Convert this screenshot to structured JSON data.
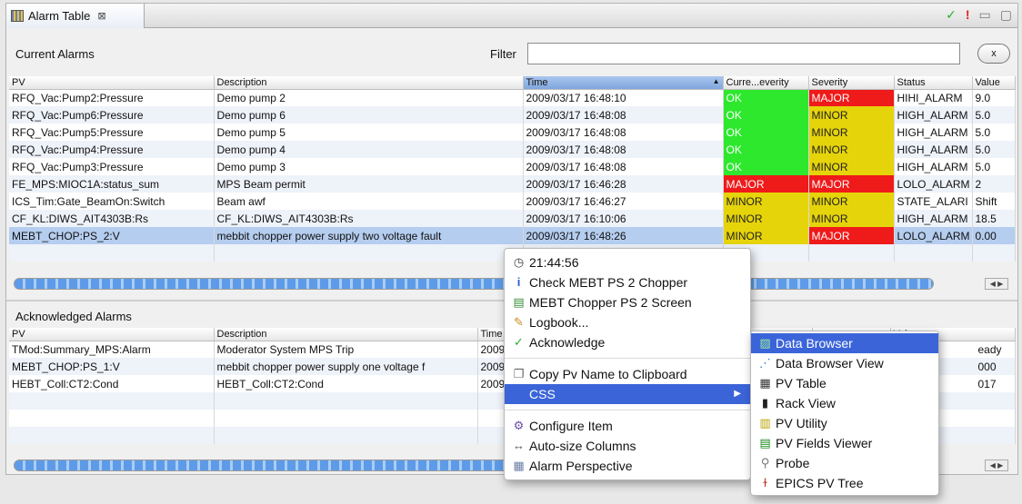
{
  "tab": {
    "title": "Alarm Table",
    "close": "⊠"
  },
  "toolbar_icons": {
    "check": "✓",
    "alert": "!",
    "minimize": "▭",
    "maximize": "▢"
  },
  "current": {
    "title": "Current Alarms",
    "filter_label": "Filter",
    "filter_value": "",
    "clear_label": "x",
    "columns": [
      "PV",
      "Description",
      "Time",
      "Curre...everity",
      "Severity",
      "Status",
      "Value"
    ],
    "rows": [
      {
        "pv": "RFQ_Vac:Pump2:Pressure",
        "desc": "Demo pump 2",
        "time": "2009/03/17 16:48:10",
        "cur": "OK",
        "sev": "MAJOR",
        "status": "HIHI_ALARM",
        "value": "9.0"
      },
      {
        "pv": "RFQ_Vac:Pump6:Pressure",
        "desc": "Demo pump 6",
        "time": "2009/03/17 16:48:08",
        "cur": "OK",
        "sev": "MINOR",
        "status": "HIGH_ALARM",
        "value": "5.0"
      },
      {
        "pv": "RFQ_Vac:Pump5:Pressure",
        "desc": "Demo pump 5",
        "time": "2009/03/17 16:48:08",
        "cur": "OK",
        "sev": "MINOR",
        "status": "HIGH_ALARM",
        "value": "5.0"
      },
      {
        "pv": "RFQ_Vac:Pump4:Pressure",
        "desc": "Demo pump 4",
        "time": "2009/03/17 16:48:08",
        "cur": "OK",
        "sev": "MINOR",
        "status": "HIGH_ALARM",
        "value": "5.0"
      },
      {
        "pv": "RFQ_Vac:Pump3:Pressure",
        "desc": "Demo pump 3",
        "time": "2009/03/17 16:48:08",
        "cur": "OK",
        "sev": "MINOR",
        "status": "HIGH_ALARM",
        "value": "5.0"
      },
      {
        "pv": "FE_MPS:MIOC1A:status_sum",
        "desc": "MPS Beam permit",
        "time": "2009/03/17 16:46:28",
        "cur": "MAJOR",
        "sev": "MAJOR",
        "status": "LOLO_ALARM",
        "value": "2"
      },
      {
        "pv": "ICS_Tim:Gate_BeamOn:Switch",
        "desc": "Beam awf",
        "time": "2009/03/17 16:46:27",
        "cur": "MINOR",
        "sev": "MINOR",
        "status": "STATE_ALARI",
        "value": "Shift"
      },
      {
        "pv": "CF_KL:DIWS_AIT4303B:Rs",
        "desc": "CF_KL:DIWS_AIT4303B:Rs",
        "time": "2009/03/17 16:10:06",
        "cur": "MINOR",
        "sev": "MINOR",
        "status": "HIGH_ALARM",
        "value": "18.5"
      },
      {
        "pv": "MEBT_CHOP:PS_2:V",
        "desc": "mebbit chopper power supply two voltage fault",
        "time": "2009/03/17 16:48:26",
        "cur": "MINOR",
        "sev": "MAJOR",
        "status": "LOLO_ALARM",
        "value": "0.00"
      }
    ]
  },
  "acknowledged": {
    "title": "Acknowledged Alarms",
    "columns": [
      "PV",
      "Description",
      "Time",
      "",
      "",
      "",
      "Value"
    ],
    "rows": [
      {
        "pv": "TMod:Summary_MPS:Alarm",
        "desc": "Moderator System MPS Trip",
        "time": "2009",
        "value": "eady"
      },
      {
        "pv": "MEBT_CHOP:PS_1:V",
        "desc": "mebbit chopper power supply one voltage f",
        "time": "2009",
        "value": "000"
      },
      {
        "pv": "HEBT_Coll:CT2:Cond",
        "desc": "HEBT_Coll:CT2:Cond",
        "time": "2009",
        "value": "017"
      }
    ]
  },
  "context_menu": {
    "items": [
      {
        "label": "21:44:56",
        "icon": "clock-icon",
        "glyph": "◷"
      },
      {
        "label": "Check MEBT PS 2 Chopper",
        "icon": "info-icon",
        "glyph": "i"
      },
      {
        "label": "MEBT Chopper PS 2 Screen",
        "icon": "screen-icon",
        "glyph": "▤"
      },
      {
        "label": "Logbook...",
        "icon": "pencil-icon",
        "glyph": "✎"
      },
      {
        "label": "Acknowledge",
        "icon": "check-icon",
        "glyph": "✓"
      },
      {
        "label": "Copy Pv Name to Clipboard",
        "icon": "copy-icon",
        "glyph": "❐"
      },
      {
        "label": "CSS",
        "icon": "",
        "glyph": "",
        "submenu": true
      },
      {
        "label": "Configure Item",
        "icon": "configure-icon",
        "glyph": "⚙"
      },
      {
        "label": "Auto-size Columns",
        "icon": "autosize-icon",
        "glyph": "↔"
      },
      {
        "label": "Alarm Perspective",
        "icon": "perspective-icon",
        "glyph": "▦"
      }
    ],
    "submenu_arrow": "▶"
  },
  "css_submenu": {
    "items": [
      {
        "label": "Data Browser",
        "icon": "data-browser-icon",
        "glyph": "▨"
      },
      {
        "label": "Data Browser View",
        "icon": "data-browser-view-icon",
        "glyph": "⋰"
      },
      {
        "label": "PV Table",
        "icon": "pv-table-icon",
        "glyph": "▦"
      },
      {
        "label": "Rack View",
        "icon": "rack-view-icon",
        "glyph": "▮"
      },
      {
        "label": "PV Utility",
        "icon": "pv-utility-icon",
        "glyph": "▥"
      },
      {
        "label": "PV Fields Viewer",
        "icon": "pv-fields-icon",
        "glyph": "▤"
      },
      {
        "label": "Probe",
        "icon": "probe-icon",
        "glyph": "⚲"
      },
      {
        "label": "EPICS PV Tree",
        "icon": "pv-tree-icon",
        "glyph": "ɫ"
      }
    ]
  },
  "colors": {
    "ok": "#2ee82e",
    "minor": "#e6d40a",
    "major": "#ef1a1a",
    "highlight": "#3b64d9",
    "selection": "#b5cdef"
  }
}
